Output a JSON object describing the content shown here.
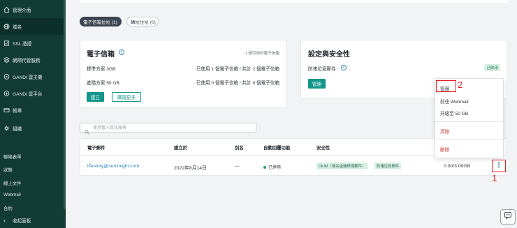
{
  "sidebar": {
    "items": [
      {
        "label": "管理介面",
        "icon": "home-icon"
      },
      {
        "label": "域名",
        "icon": "globe-icon"
      },
      {
        "label": "SSL 憑證",
        "icon": "ssl-icon"
      },
      {
        "label": "網際代管服務",
        "icon": "hosting-icon"
      },
      {
        "label": "GANDI 雲主機",
        "icon": "cloud-icon"
      },
      {
        "label": "GANDI 雲平台",
        "icon": "cloud-platform-icon"
      },
      {
        "label": "帳單",
        "icon": "billing-icon"
      },
      {
        "label": "組織",
        "icon": "organization-icon"
      }
    ],
    "links": [
      "聯絡表單",
      "狀態",
      "線上文件",
      "Webmail",
      "合約"
    ],
    "collapse_label": "收起面板"
  },
  "tabs": [
    {
      "label": "電子信箱位址 (1)",
      "active": true
    },
    {
      "label": "轉址位址 (0)",
      "active": false
    }
  ],
  "mail_card": {
    "title": "電子信箱",
    "available_note": "1 個可用的電子信箱",
    "rows": [
      {
        "plan": "標準方案 3GB",
        "usage": "已使用 1 個電子信箱 / 共計 2 個電子信箱"
      },
      {
        "plan": "進階方案 50 GB",
        "usage": "已使用 0 個電子信箱 / 共計 0 個電子信箱"
      }
    ],
    "create_label": "建立",
    "buy_more_label": "購買更多"
  },
  "security_card": {
    "title": "設定與安全性",
    "antispam_label": "防堵垃圾郵件",
    "antispam_status": "已啟用",
    "manage_label": "管理"
  },
  "search": {
    "placeholder": "使用管人資訊搜尋"
  },
  "table": {
    "headers": [
      "電子郵件",
      "建立於",
      "別名",
      "自動回覆功能",
      "安全性"
    ],
    "rows": [
      {
        "email": "lifestory@sunxnight.com",
        "created": "2022年8月14日",
        "alias": "—",
        "autoreply": "已停用",
        "security_tags": [
          "DKIM（域名金鑰辨識郵件）",
          "防堵垃圾郵件"
        ],
        "quota": "0.00/3.00GB"
      }
    ]
  },
  "menu": {
    "items": [
      {
        "label": "管理",
        "danger": false
      },
      {
        "label": "前往 Webmail",
        "danger": false
      },
      {
        "label": "升級至 50 GB",
        "danger": false
      },
      {
        "label": "清除",
        "danger": true
      },
      {
        "label": "刪除",
        "danger": true
      }
    ]
  },
  "annotations": {
    "one": "1",
    "two": "2"
  },
  "colors": {
    "sidebar_bg": "#123b34",
    "accent": "#13958a",
    "annotation_red": "#e0202a",
    "link_blue": "#1f7fb5"
  }
}
